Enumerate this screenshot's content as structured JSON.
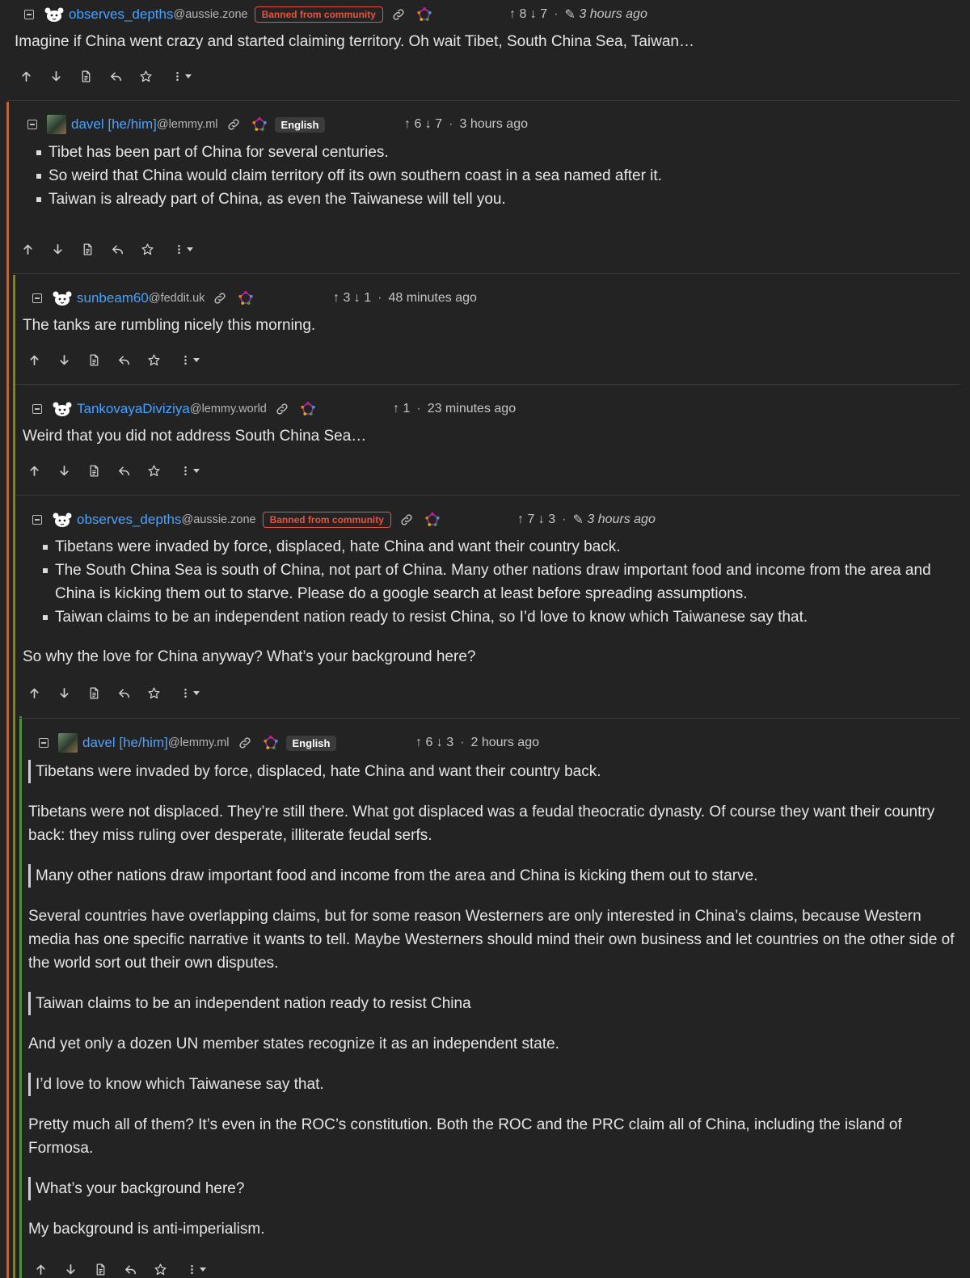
{
  "comments": [
    {
      "username": "observes_depths",
      "instance": "@aussie.zone",
      "badge": "Banned from community",
      "up": "8",
      "down": "7",
      "time": "3 hours ago",
      "paragraph": "Imagine if China went crazy and started claiming territory. Oh wait Tibet, South China Sea, Taiwan…"
    },
    {
      "username": "davel [he/him]",
      "instance": "@lemmy.ml",
      "language": "English",
      "up": "6",
      "down": "7",
      "time": "3 hours ago",
      "bullets": [
        "Tibet has been part of China for several centuries.",
        "So weird that China would claim territory off its own southern coast in a sea named after it.",
        "Taiwan is already part of China, as even the Taiwanese will tell you."
      ]
    },
    {
      "username": "sunbeam60",
      "instance": "@feddit.uk",
      "up": "3",
      "down": "1",
      "time": "48 minutes ago",
      "paragraph": "The tanks are rumbling nicely this morning."
    },
    {
      "username": "TankovayaDiviziya",
      "instance": "@lemmy.world",
      "up": "1",
      "time": "23 minutes ago",
      "paragraph": "Weird that you did not address South China Sea…"
    },
    {
      "username": "observes_depths",
      "instance": "@aussie.zone",
      "badge": "Banned from community",
      "up": "7",
      "down": "3",
      "time": "3 hours ago",
      "bullets": [
        "Tibetans were invaded by force, displaced, hate China and want their country back.",
        "The South China Sea is south of China, not part of China. Many other nations draw important food and income from the area and China is kicking them out to starve. Please do a google search at least before spreading assumptions.",
        "Taiwan claims to be an independent nation ready to resist China, so I’d love to know which Taiwanese say that."
      ],
      "paragraph": "So why the love for China anyway? What’s your background here?"
    },
    {
      "username": "davel [he/him]",
      "instance": "@lemmy.ml",
      "language": "English",
      "up": "6",
      "down": "3",
      "time": "2 hours ago",
      "blocks": [
        {
          "quote": "Tibetans were invaded by force, displaced, hate China and want their country back."
        },
        {
          "text": "Tibetans were not displaced. They’re still there. What got displaced was a feudal theocratic dynasty. Of course they want their country back: they miss ruling over desperate, illiterate feudal serfs."
        },
        {
          "quote": "Many other nations draw important food and income from the area and China is kicking them out to starve."
        },
        {
          "text": "Several countries have overlapping claims, but for some reason Westerners are only interested in China’s claims, because Western media has one specific narrative it wants to tell. Maybe Westerners should mind their own business and let countries on the other side of the world sort out their own disputes."
        },
        {
          "quote": "Taiwan claims to be an independent nation ready to resist China"
        },
        {
          "text": "And yet only a dozen UN member states recognize it as an independent state."
        },
        {
          "quote": "I’d love to know which Taiwanese say that."
        },
        {
          "text": "Pretty much all of them? It’s even in the ROC’s constitution. Both the ROC and the PRC claim all of China, including the island of Formosa."
        },
        {
          "quote": "What’s your background here?"
        },
        {
          "text": "My background is anti-imperialism."
        }
      ]
    }
  ],
  "icons": {
    "collapse": "minus-square-icon",
    "link": "link-icon",
    "federation": "fediverse-icon",
    "upvote": "arrow-up-icon",
    "downvote": "arrow-down-icon",
    "source": "document-icon",
    "reply": "reply-icon",
    "save": "star-icon",
    "more": "more-vertical-icon"
  },
  "colors": {
    "background": "#232323",
    "username": "#4aa2ff",
    "banned": "#e55342",
    "rail_1": "#b8663a",
    "rail_2": "#7d7d3c",
    "rail_3": "#4f8f45"
  }
}
